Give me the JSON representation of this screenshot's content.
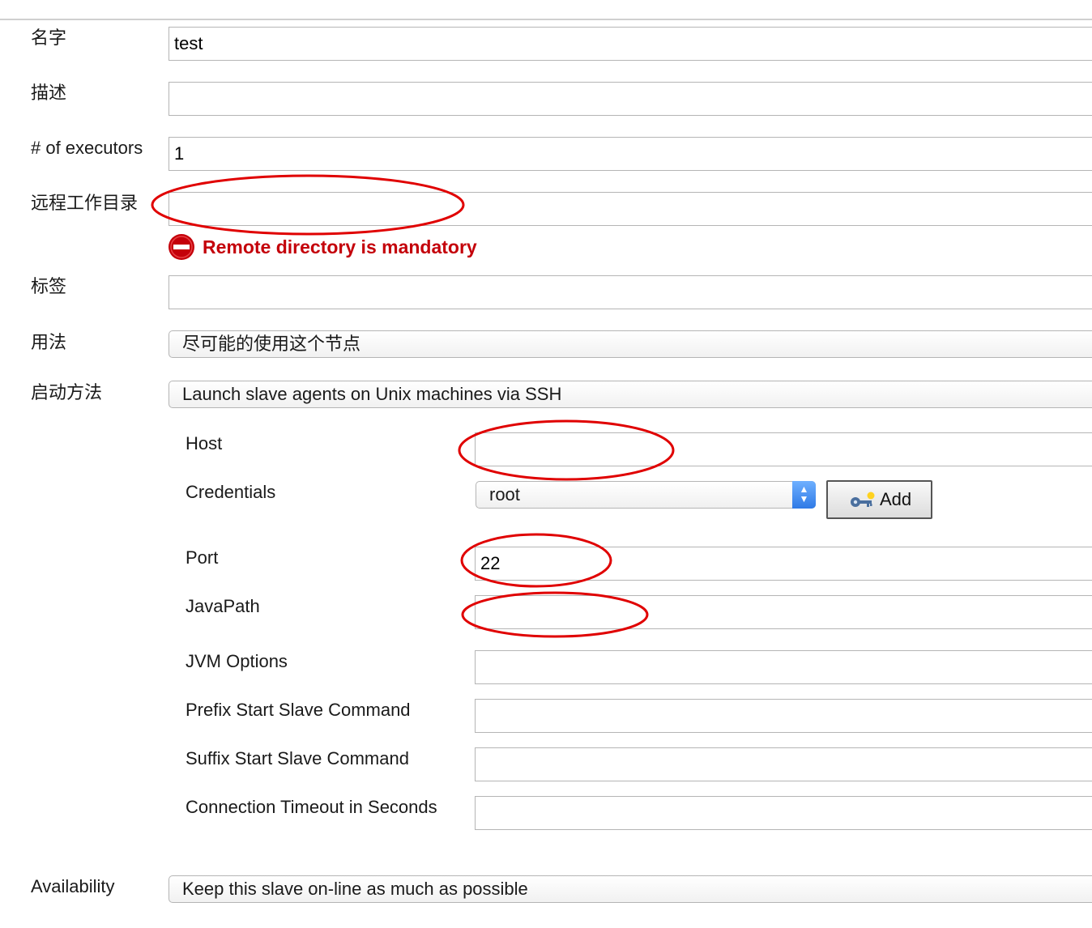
{
  "form": {
    "name_label": "名字",
    "name_value": "test",
    "description_label": "描述",
    "description_value": "",
    "executors_label": "# of executors",
    "executors_value": "1",
    "remote_dir_label": "远程工作目录",
    "remote_dir_value": "",
    "remote_dir_error": "Remote directory is mandatory",
    "labels_label": "标签",
    "labels_value": "",
    "usage_label": "用法",
    "usage_value": "尽可能的使用这个节点",
    "launch_label": "启动方法",
    "launch_value": "Launch slave agents on Unix machines via SSH",
    "availability_label": "Availability",
    "availability_value": "Keep this slave on-line as much as possible"
  },
  "ssh": {
    "host_label": "Host",
    "host_value": "",
    "credentials_label": "Credentials",
    "credentials_value": "root",
    "add_button": "Add",
    "port_label": "Port",
    "port_value": "22",
    "javapath_label": "JavaPath",
    "javapath_value": "",
    "jvm_label": "JVM Options",
    "jvm_value": "",
    "prefix_label": "Prefix Start Slave Command",
    "prefix_value": "",
    "suffix_label": "Suffix Start Slave Command",
    "suffix_value": "",
    "timeout_label": "Connection Timeout in Seconds",
    "timeout_value": ""
  },
  "colors": {
    "error": "#c4000a",
    "annotation": "#e00000",
    "select_arrow": "#2f7ae6"
  },
  "icons": {
    "error": "error-circle-icon",
    "add_button": "key-icon",
    "select": "updown-arrows-icon"
  }
}
